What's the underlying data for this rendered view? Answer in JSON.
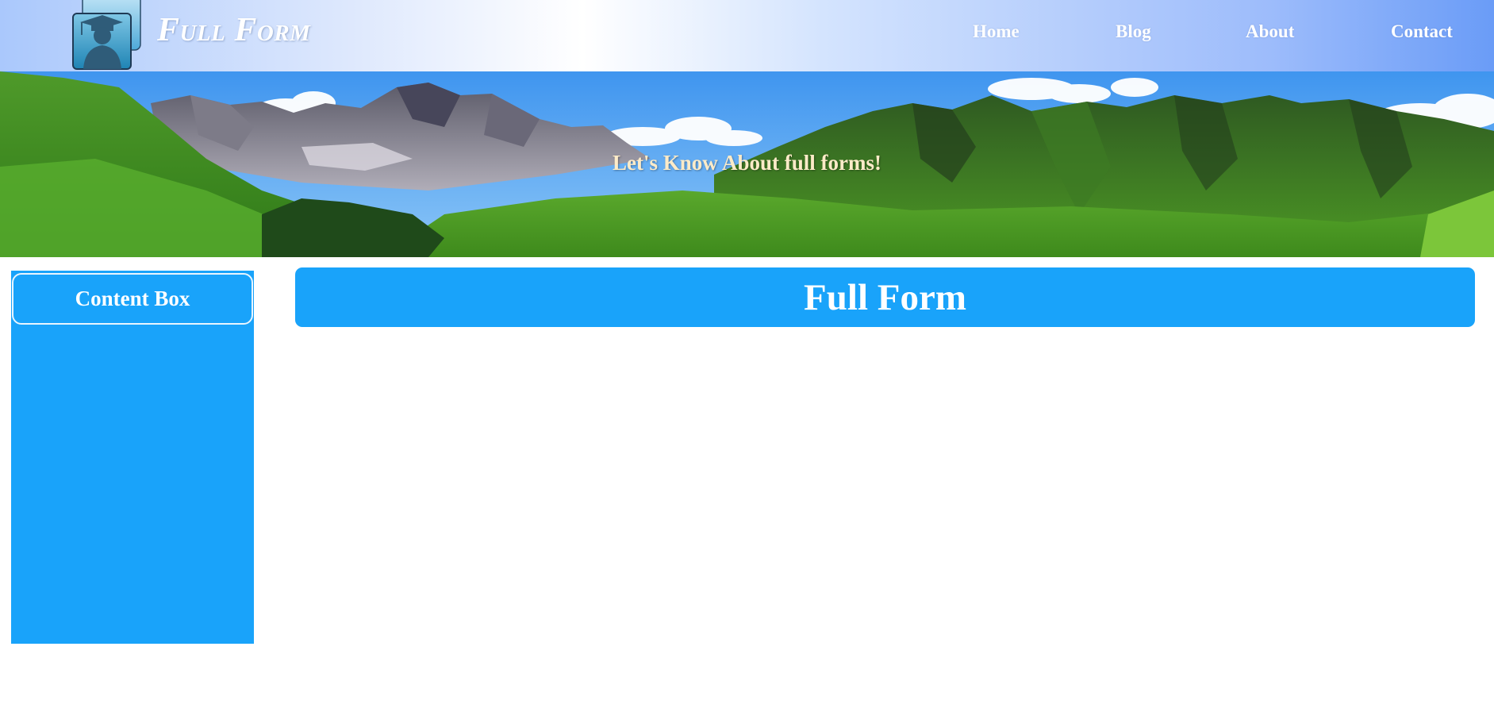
{
  "brand": {
    "name": "Full Form",
    "logo_icon": "graduate-silhouette-icon"
  },
  "nav": {
    "items": [
      {
        "label": "Home"
      },
      {
        "label": "Blog"
      },
      {
        "label": "About"
      },
      {
        "label": "Contact"
      }
    ]
  },
  "hero": {
    "tagline": "Let's Know About full forms!"
  },
  "sidebar": {
    "title": "Content Box"
  },
  "main": {
    "title": "Full Form"
  },
  "colors": {
    "panel_blue": "#19a3fa",
    "tagline": "#fdebc8",
    "nav_text": "#ffffff"
  }
}
